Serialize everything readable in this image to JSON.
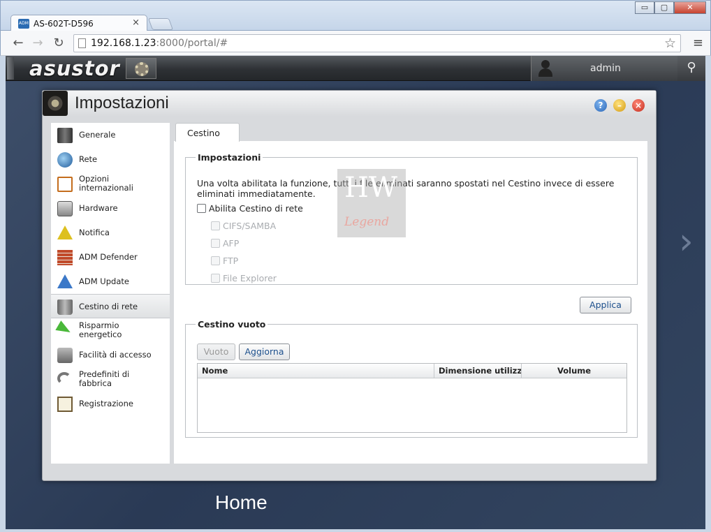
{
  "browser": {
    "tab_title": "AS-602T-D596",
    "tab_close": "×",
    "url_host": "192.168.1.23",
    "url_rest": ":8000/portal/#",
    "window_buttons": {
      "minimize": "▭",
      "maximize": "▢",
      "close": "✕"
    }
  },
  "adm": {
    "logo": "asustor",
    "username": "admin"
  },
  "window": {
    "title": "Impostazioni",
    "help_label": "?",
    "minimize_label": "–",
    "close_label": "×"
  },
  "sidebar": {
    "items": [
      {
        "label": "Generale",
        "icon": "server-icon"
      },
      {
        "label": "Rete",
        "icon": "globe-icon"
      },
      {
        "label": "Opzioni internazionali",
        "icon": "calendar-clock-icon"
      },
      {
        "label": "Hardware",
        "icon": "hard-drive-icon"
      },
      {
        "label": "Notifica",
        "icon": "warning-icon"
      },
      {
        "label": "ADM Defender",
        "icon": "firewall-icon"
      },
      {
        "label": "ADM Update",
        "icon": "arrow-up-icon"
      },
      {
        "label": "Cestino di rete",
        "icon": "trash-icon",
        "active": true
      },
      {
        "label": "Risparmio energetico",
        "icon": "lightning-icon"
      },
      {
        "label": "Facilità di accesso",
        "icon": "printer-icon"
      },
      {
        "label": "Predefiniti di fabbrica",
        "icon": "undo-arrow-icon"
      },
      {
        "label": "Registrazione",
        "icon": "clipboard-icon"
      }
    ]
  },
  "content": {
    "tab": "Cestino",
    "settings": {
      "legend": "Impostazioni",
      "description": "Una volta abilitata la funzione, tutti i file eliminati saranno spostati nel Cestino invece di essere eliminati immediatamente.",
      "enable_label": "Abilita Cestino di rete",
      "services": [
        "CIFS/SAMBA",
        "AFP",
        "FTP",
        "File Explorer"
      ]
    },
    "apply_button": "Applica",
    "empty_trash": {
      "legend": "Cestino vuoto",
      "empty_button": "Vuoto",
      "refresh_button": "Aggiorna",
      "columns": [
        "Nome",
        "Dimensione utilizzata",
        "Volume"
      ]
    }
  },
  "desktop": {
    "home_label": "Home",
    "next_arrow": "›"
  },
  "watermark": {
    "top": "HW",
    "bottom": "Legend"
  },
  "colors": {
    "adm_bar": "#2e3135",
    "desktop": "#2a3a55",
    "link_blue": "#1c4f8c"
  }
}
